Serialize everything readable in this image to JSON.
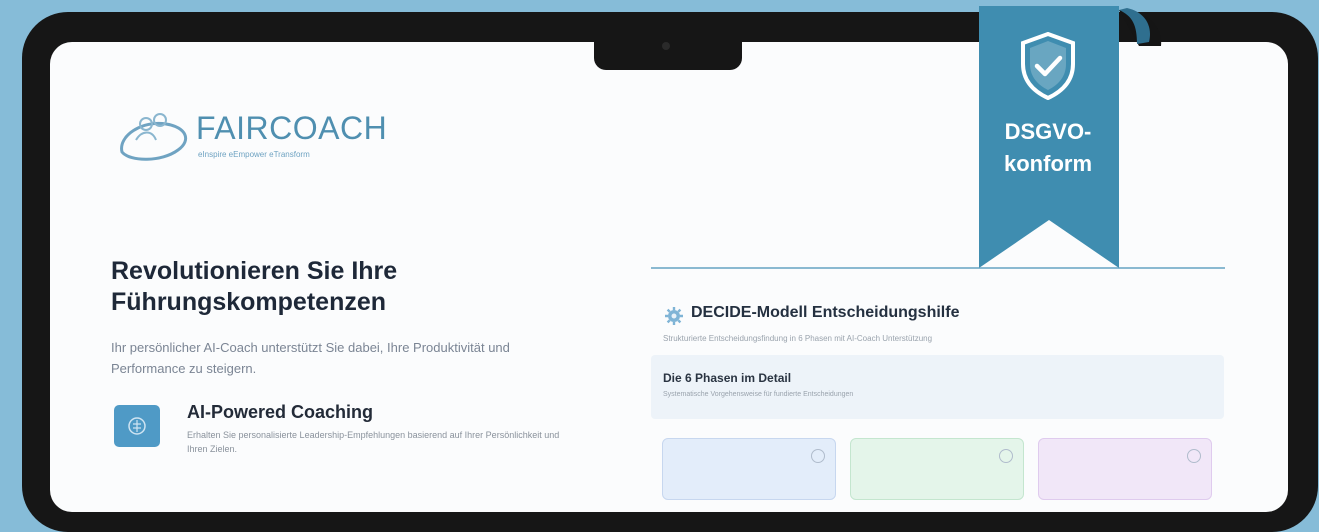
{
  "brand": {
    "name": "FAIRCOACH",
    "tagline": "eInspire eEmpower eTransform",
    "accent": "#4f8fb0"
  },
  "hero": {
    "heading": "Revolutionieren Sie Ihre Führungskompetenzen",
    "subtext": "Ihr persönlicher AI-Coach unterstützt Sie dabei, Ihre Produktivität und Performance zu steigern."
  },
  "feature": {
    "icon": "ai-brain-icon",
    "title": "AI-Powered Coaching",
    "description": "Erhalten Sie personalisierte Leadership-Empfehlungen basierend auf Ihrer Persönlichkeit und Ihren Zielen."
  },
  "decide_panel": {
    "icon": "gear-icon",
    "title": "DECIDE-Modell Entscheidungshilfe",
    "subtitle": "Strukturierte Entscheidungsfindung in 6 Phasen mit AI-Coach Unterstützung",
    "phases": {
      "title": "Die 6 Phasen im Detail",
      "subtitle": "Systematische Vorgehensweise für fundierte Entscheidungen"
    },
    "cards": [
      {
        "color": "#e3edfa"
      },
      {
        "color": "#e4f5ea"
      },
      {
        "color": "#f1e7f8"
      }
    ]
  },
  "badge": {
    "line1": "DSGVO-",
    "line2": "konform",
    "icon": "shield-check-icon",
    "color": "#3f8db0"
  }
}
